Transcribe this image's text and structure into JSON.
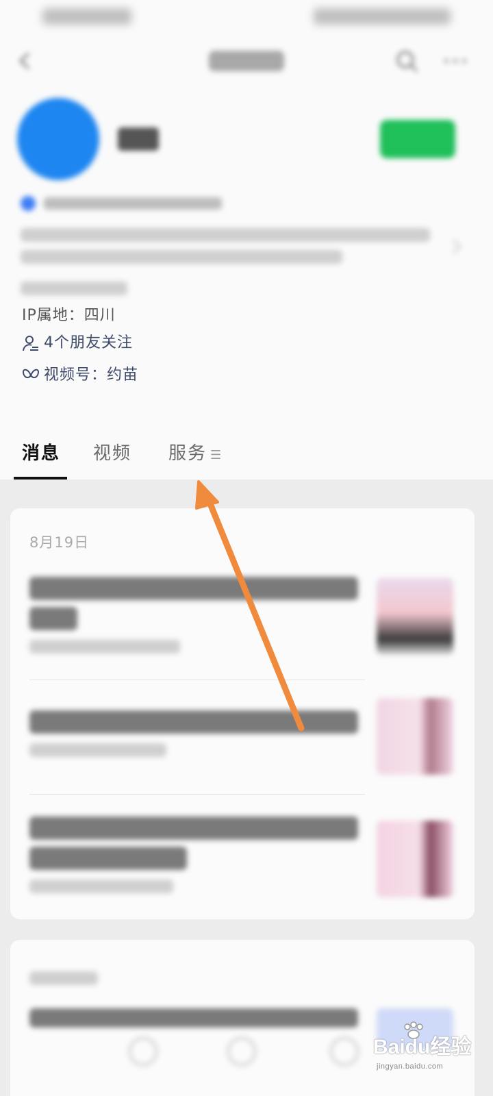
{
  "profile": {
    "ip_location": "IP属地：四川",
    "friends_following": "4个朋友关注",
    "channel": "视频号：约苗"
  },
  "tabs": [
    {
      "label": "消息",
      "active": true
    },
    {
      "label": "视频",
      "active": false
    },
    {
      "label": "服务",
      "active": false
    }
  ],
  "feed": {
    "card1_date": "8月19日"
  },
  "watermark": {
    "brand": "Baidu经验",
    "url": "jingyan.baidu.com"
  },
  "colors": {
    "avatar": "#1e86f0",
    "follow_button": "#1fbf5a",
    "annotation_arrow": "#f08a3c",
    "friends_text": "#3e4a6a"
  },
  "icons": {
    "friends": "person-outline-icon",
    "channel": "butterfly-icon",
    "tab_more": "menu-lines-icon"
  }
}
